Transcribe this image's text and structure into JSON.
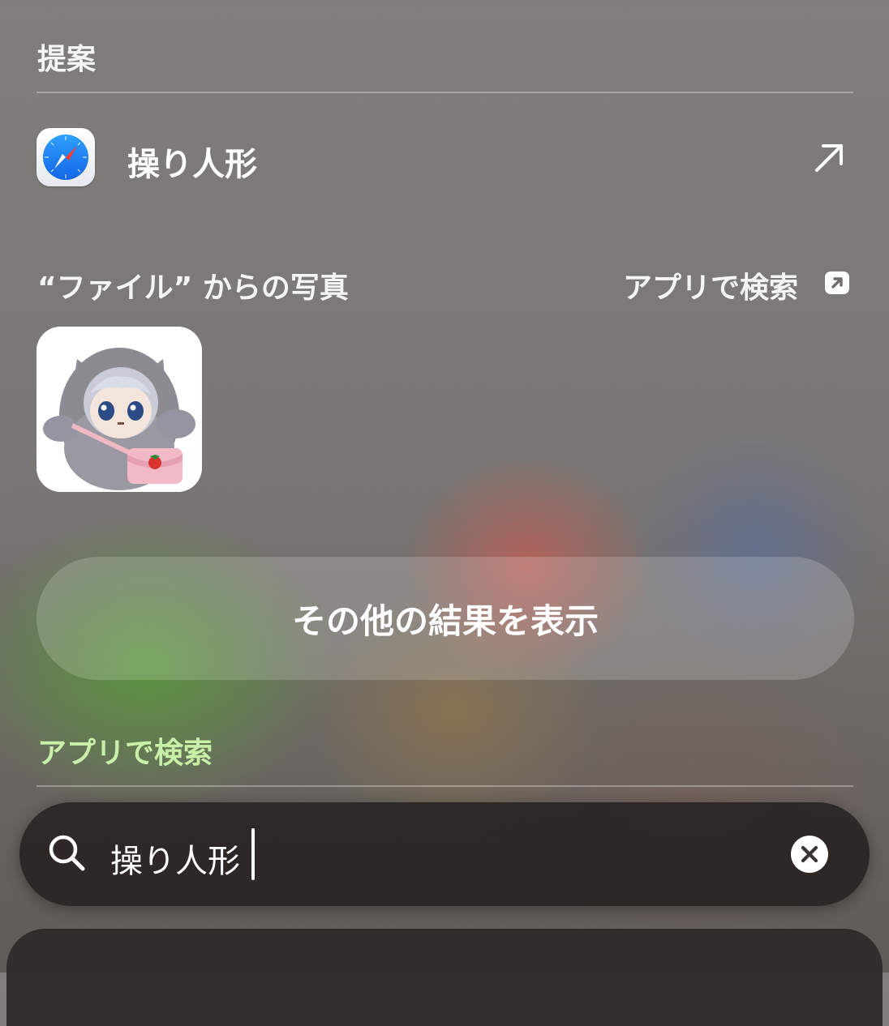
{
  "suggestions": {
    "header": "提案",
    "item_label": "操り人形",
    "item_app_icon": "safari-icon",
    "action_icon": "arrow-up-right-icon"
  },
  "photos": {
    "header": "“ファイル” からの写真",
    "search_in_app_label": "アプリで検索",
    "search_in_app_icon": "open-in-app-icon",
    "thumbnail_icon": "plush-doll-photo"
  },
  "more_results_label": "その他の結果を表示",
  "app_search": {
    "header": "アプリで検索",
    "header_color": "#c9f0a8"
  },
  "search_bar": {
    "query": "操り人形",
    "search_icon": "search-icon",
    "clear_icon": "clear-icon"
  }
}
